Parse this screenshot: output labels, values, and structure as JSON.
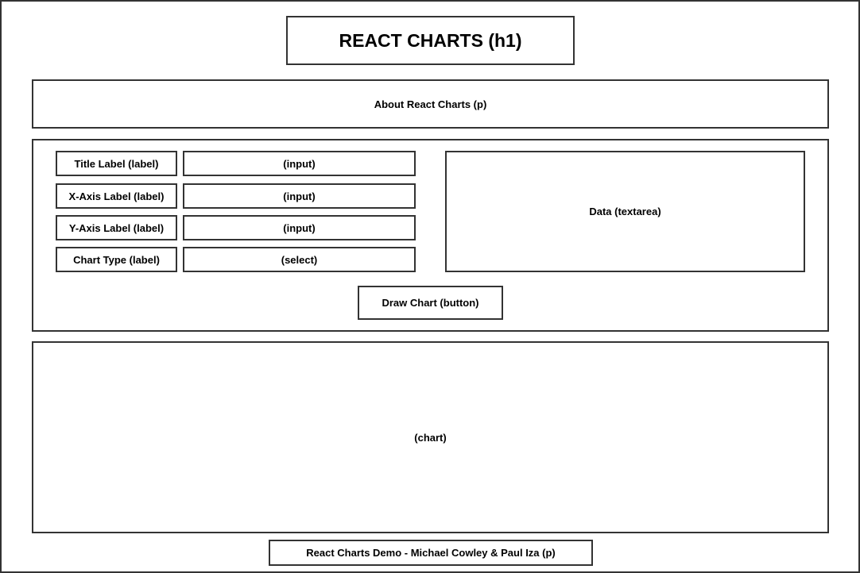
{
  "header": {
    "title": "REACT CHARTS (h1)"
  },
  "about": {
    "text": "About React Charts (p)"
  },
  "form": {
    "title_label": "Title Label (label)",
    "title_input": "(input)",
    "xaxis_label": "X-Axis Label (label)",
    "xaxis_input": "(input)",
    "yaxis_label": "Y-Axis Label (label)",
    "yaxis_input": "(input)",
    "charttype_label": "Chart Type (label)",
    "charttype_select": "(select)",
    "data_textarea": "Data (textarea)",
    "draw_button": "Draw Chart (button)"
  },
  "chart": {
    "text": "(chart)"
  },
  "footer": {
    "text": "React Charts Demo - Michael Cowley & Paul Iza (p)"
  }
}
